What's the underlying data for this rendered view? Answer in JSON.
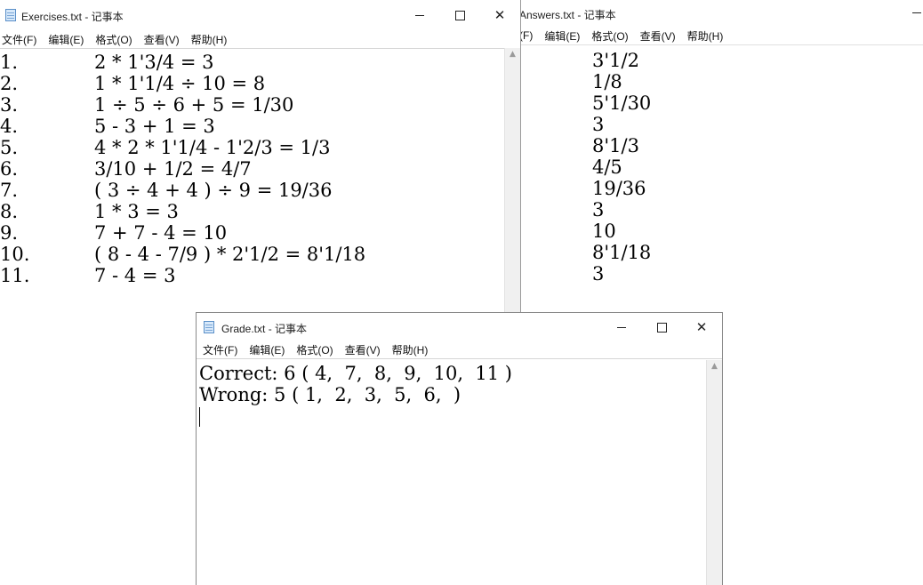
{
  "menu": [
    "文件(F)",
    "编辑(E)",
    "格式(O)",
    "查看(V)",
    "帮助(H)"
  ],
  "answers_window": {
    "title": "Answers.txt - 记事本",
    "menu": [
      "(F)",
      "编辑(E)",
      "格式(O)",
      "查看(V)",
      "帮助(H)"
    ],
    "lines": [
      "3'1/2",
      "1/8",
      "5'1/30",
      "3",
      "8'1/3",
      "4/5",
      "19/36",
      "3",
      "10",
      "8'1/18",
      "3"
    ]
  },
  "exercises_window": {
    "title": "Exercises.txt - 记事本",
    "lines": [
      {
        "num": "1.",
        "expr": "2 * 1'3/4 = 3"
      },
      {
        "num": "2.",
        "expr": "1 * 1'1/4 ÷ 10 = 8"
      },
      {
        "num": "3.",
        "expr": "1 ÷ 5 ÷ 6 + 5 = 1/30"
      },
      {
        "num": "4.",
        "expr": "5 - 3 + 1 = 3"
      },
      {
        "num": "5.",
        "expr": "4 * 2 * 1'1/4 - 1'2/3 = 1/3"
      },
      {
        "num": "6.",
        "expr": "3/10 + 1/2 = 4/7"
      },
      {
        "num": "7.",
        "expr": "( 3 ÷ 4 + 4 ) ÷ 9 = 19/36"
      },
      {
        "num": "8.",
        "expr": "1 * 3 = 3"
      },
      {
        "num": "9.",
        "expr": "7 + 7 - 4 = 10"
      },
      {
        "num": "10.",
        "expr": "( 8 - 4 - 7/9 ) * 2'1/2 = 8'1/18"
      },
      {
        "num": "11.",
        "expr": "7 - 4 = 3"
      }
    ]
  },
  "grade_window": {
    "title": "Grade.txt - 记事本",
    "lines": [
      "Correct: 6 ( 4,  7,  8,  9,  10,  11 )",
      "Wrong: 5 ( 1,  2,  3,  5,  6,  )"
    ]
  },
  "icons": {
    "app": "notepad-icon",
    "minimize": "minimize-icon",
    "maximize": "maximize-icon",
    "close": "close-icon",
    "scroll_up": "scroll-up-arrow-icon"
  }
}
